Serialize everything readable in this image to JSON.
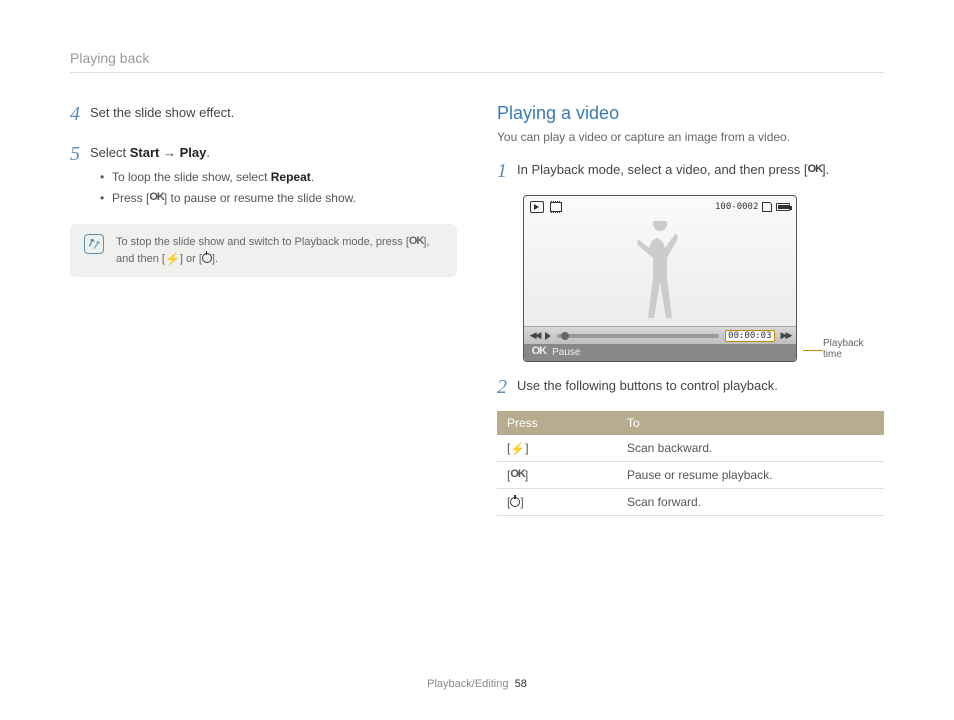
{
  "header": "Playing back",
  "left": {
    "step4": {
      "num": "4",
      "text": "Set the slide show effect."
    },
    "step5": {
      "num": "5",
      "prefix": "Select ",
      "start": "Start",
      "arrow": " → ",
      "play": "Play",
      "suffix": ".",
      "b1a": "To loop the slide show, select ",
      "b1b": "Repeat",
      "b1c": ".",
      "b2a": "Press [",
      "b2ok": "OK",
      "b2b": "] to pause or resume the slide show."
    },
    "note": {
      "t1": "To stop the slide show and switch to Playback mode, press [",
      "ok": "OK",
      "t2": "], and then [",
      "flash": "⚡",
      "t3": "] or [",
      "t4": "]."
    }
  },
  "right": {
    "title": "Playing a video",
    "sub": "You can play a video or capture an image from a video.",
    "step1": {
      "num": "1",
      "t1": "In Playback mode, select a video, and then press [",
      "ok": "OK",
      "t2": "]."
    },
    "video": {
      "counter": "100-0002",
      "time": "00:00:03",
      "pause_ok": "OK",
      "pause_label": "Pause",
      "callout": "Playback time"
    },
    "step2": {
      "num": "2",
      "text": "Use the following buttons to control playback."
    },
    "table": {
      "h1": "Press",
      "h2": "To",
      "r1b": "Scan backward.",
      "r2a": "OK",
      "r2b": "Pause or resume playback.",
      "r3b": "Scan forward."
    }
  },
  "footer": {
    "section": "Playback/Editing",
    "page": "58"
  }
}
